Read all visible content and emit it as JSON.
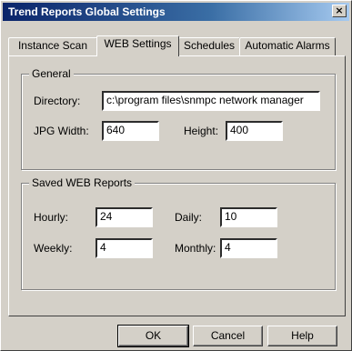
{
  "window": {
    "title": "Trend Reports Global Settings",
    "close_glyph": "×"
  },
  "tabs": [
    {
      "label": "Instance Scan",
      "active": false
    },
    {
      "label": "WEB Settings",
      "active": true
    },
    {
      "label": "Schedules",
      "active": false
    },
    {
      "label": "Automatic Alarms",
      "active": false
    }
  ],
  "general": {
    "group_label": "General",
    "directory_label": "Directory:",
    "directory_value": "c:\\program files\\snmpc network manager",
    "jpg_width_label": "JPG Width:",
    "jpg_width_value": "640",
    "height_label": "Height:",
    "height_value": "400"
  },
  "saved_reports": {
    "group_label": "Saved WEB Reports",
    "hourly_label": "Hourly:",
    "hourly_value": "24",
    "daily_label": "Daily:",
    "daily_value": "10",
    "weekly_label": "Weekly:",
    "weekly_value": "4",
    "monthly_label": "Monthly:",
    "monthly_value": "4"
  },
  "buttons": {
    "ok": "OK",
    "cancel": "Cancel",
    "help": "Help"
  }
}
